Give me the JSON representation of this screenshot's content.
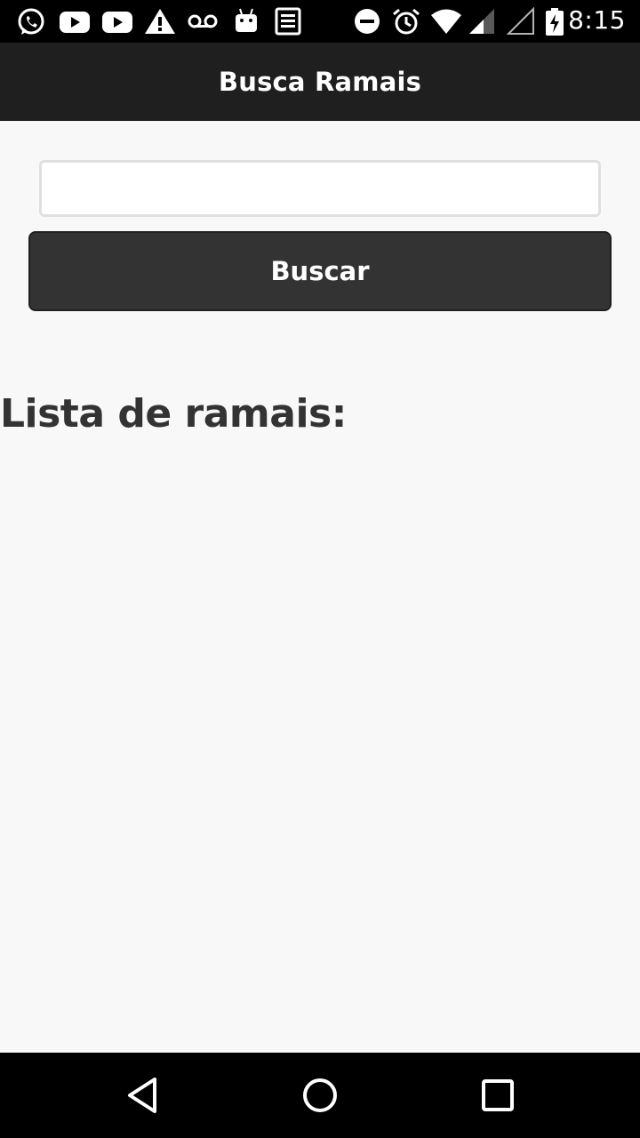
{
  "status_bar": {
    "time": "8:15",
    "left_icons": [
      "whatsapp-icon",
      "youtube-icon",
      "youtube-icon",
      "warning-icon",
      "voicemail-icon",
      "android-icon",
      "news-icon"
    ],
    "right_icons": [
      "do-not-disturb-icon",
      "alarm-icon",
      "wifi-icon",
      "signal-icon",
      "signal-empty-icon",
      "battery-charging-icon"
    ]
  },
  "header": {
    "title": "Busca Ramais"
  },
  "search": {
    "value": "",
    "placeholder": "",
    "button_label": "Buscar"
  },
  "list": {
    "heading": "Lista de ramais:",
    "items": []
  },
  "nav": {
    "buttons": [
      "back-icon",
      "home-icon",
      "recents-icon"
    ]
  },
  "colors": {
    "header_bg": "#1f1f1f",
    "button_bg": "#333333",
    "page_bg": "#f8f8f8",
    "heading_text": "#333333"
  }
}
